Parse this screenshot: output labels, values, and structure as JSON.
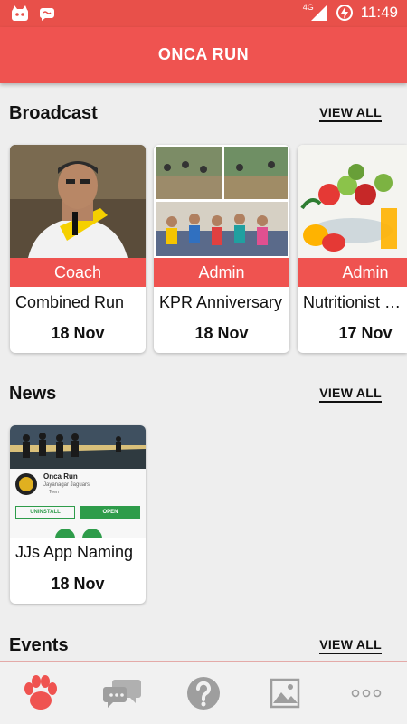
{
  "status_bar": {
    "network": "4G",
    "time": "11:49",
    "icons": [
      "cat-notification-icon",
      "chat-wave-icon",
      "signal-icon",
      "battery-charging-icon"
    ]
  },
  "app": {
    "title": "ONCA RUN"
  },
  "broadcast": {
    "title": "Broadcast",
    "view_all": "VIEW ALL",
    "cards": [
      {
        "badge": "Coach",
        "title": "Combined Run",
        "date": "18 Nov"
      },
      {
        "badge": "Admin",
        "title": "KPR Anniversary",
        "date": "18 Nov"
      },
      {
        "badge": "Admin",
        "title": "Nutritionist Session",
        "date": "17 Nov"
      }
    ]
  },
  "news": {
    "title": "News",
    "view_all": "VIEW ALL",
    "cards": [
      {
        "title": "JJs App Naming",
        "date": "18 Nov",
        "preview": {
          "app_name": "Onca Run",
          "developer": "Jayanagar Jaguars",
          "rating": "Teen",
          "uninstall": "UNINSTALL",
          "open": "OPEN"
        }
      }
    ]
  },
  "events": {
    "title": "Events",
    "view_all": "VIEW ALL"
  },
  "bottom_nav": {
    "items": [
      "paw-icon",
      "chat-icon",
      "help-icon",
      "gallery-icon",
      "more-icon"
    ],
    "active_color": "#ef5350",
    "inactive_color": "#9e9e9e"
  },
  "colors": {
    "primary": "#ef5350",
    "status": "#e8504a"
  }
}
